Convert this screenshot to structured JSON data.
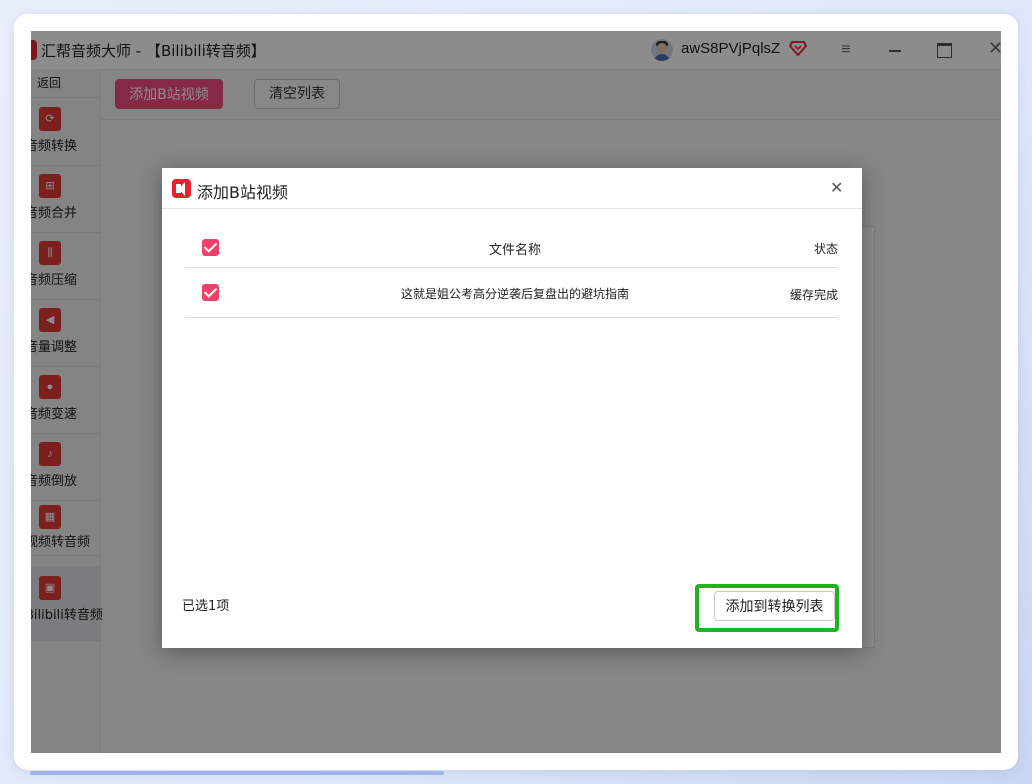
{
  "window": {
    "app_title": "汇帮音频大师 - 【Bilibili转音频】",
    "username": "awS8PVjPqlsZ"
  },
  "sidebar": {
    "back_label": "返回",
    "items": [
      {
        "label": "音频转换",
        "icon": "audio-convert-icon"
      },
      {
        "label": "音频合并",
        "icon": "audio-merge-icon"
      },
      {
        "label": "音频压缩",
        "icon": "audio-compress-icon"
      },
      {
        "label": "音量调整",
        "icon": "volume-adjust-icon"
      },
      {
        "label": "音频变速",
        "icon": "microphone-icon"
      },
      {
        "label": "音频倒放",
        "icon": "music-note-icon"
      },
      {
        "label": "视频转音频",
        "icon": "film-icon"
      },
      {
        "label": "Bilibili转音频",
        "icon": "bilibili-tv-icon"
      }
    ]
  },
  "toolbar": {
    "add_bili_label": "添加B站视频",
    "clear_label": "清空列表"
  },
  "dialog": {
    "title": "添加B站视频",
    "columns": {
      "name": "文件名称",
      "status": "状态"
    },
    "rows": [
      {
        "checked": true,
        "name": "这就是姐公考高分逆袭后复盘出的避坑指南",
        "status": "缓存完成"
      }
    ],
    "selected_count_label": "已选1项",
    "add_to_list_label": "添加到转换列表"
  },
  "colors": {
    "accent_pink": "#f24b7d",
    "checkbox_pink": "#f0406b",
    "brand_red": "#e23a3a",
    "highlight_green": "#22b024"
  }
}
